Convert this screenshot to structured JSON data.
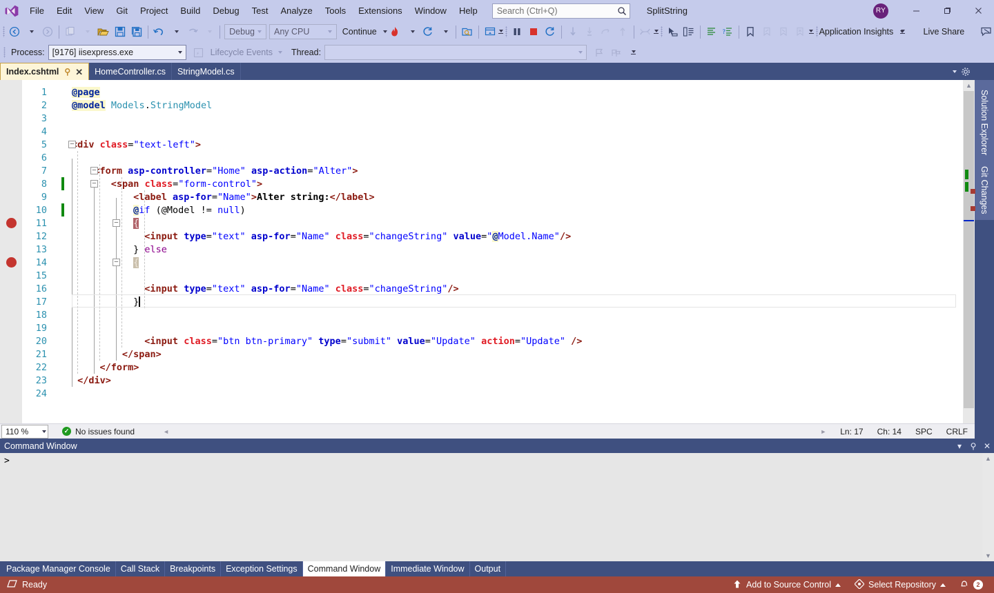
{
  "window": {
    "title": "SplitString",
    "avatar_initials": "RY",
    "minimize": "–",
    "maximize": "❐",
    "close": "✕"
  },
  "menu": {
    "items": [
      "File",
      "Edit",
      "View",
      "Git",
      "Project",
      "Build",
      "Debug",
      "Test",
      "Analyze",
      "Tools",
      "Extensions",
      "Window",
      "Help"
    ]
  },
  "search": {
    "placeholder": "Search (Ctrl+Q)",
    "icon": "search-icon"
  },
  "toolbar": {
    "nav_back": "back-arrow-icon",
    "nav_forward": "forward-arrow-icon",
    "new_item": "new-item-icon",
    "open_file": "open-folder-icon",
    "save": "save-icon",
    "save_all": "save-all-icon",
    "undo": "undo-icon",
    "redo": "redo-icon",
    "config_combo": "Debug",
    "platform_combo": "Any CPU",
    "continue_label": "Continue",
    "hot_reload": "hot-reload-icon",
    "restart_app": "restart-icon",
    "browser_select": "browser-select-icon",
    "show_window": "show-window-icon",
    "break_all": "pause-icon",
    "stop_debugging": "stop-icon",
    "restart_debug": "restart-debug-icon",
    "step_into": "step-into-icon",
    "step_over": "step-over-icon",
    "step_out": "step-out-icon",
    "step_up": "step-up-icon",
    "app_insights": "Application Insights",
    "live_share": "Live Share",
    "live_share_icon": "share-icon",
    "feedback_icon": "feedback-icon",
    "bookmark_icon": "bookmark-icon"
  },
  "processbar": {
    "process_label": "Process:",
    "process_value": "[9176] iisexpress.exe",
    "lifecycle_label": "Lifecycle Events",
    "thread_label": "Thread:",
    "thread_value": ""
  },
  "tabs": {
    "items": [
      {
        "label": "Index.cshtml",
        "active": true,
        "pin": "⚲",
        "close": "✕"
      },
      {
        "label": "HomeController.cs",
        "active": false
      },
      {
        "label": "StringModel.cs",
        "active": false
      }
    ]
  },
  "editor": {
    "breakpoint_lines": [
      11,
      14
    ],
    "changed_lines": [
      8,
      10
    ],
    "current_line": 17,
    "lines": [
      {
        "n": 1,
        "indent": 0,
        "tokens": [
          {
            "t": "@page",
            "c": "t-dir"
          }
        ]
      },
      {
        "n": 2,
        "indent": 0,
        "tokens": [
          {
            "t": "@model",
            "c": "t-dir"
          },
          {
            "t": " ",
            "c": "t-plain"
          },
          {
            "t": "Models",
            "c": "t-type"
          },
          {
            "t": ".",
            "c": "t-plain"
          },
          {
            "t": "StringModel",
            "c": "t-type"
          }
        ]
      },
      {
        "n": 3,
        "indent": 0,
        "tokens": []
      },
      {
        "n": 4,
        "indent": 0,
        "tokens": []
      },
      {
        "n": 5,
        "indent": 0,
        "tokens": [
          {
            "t": "<div ",
            "c": "t-tag"
          },
          {
            "t": "class",
            "c": "t-attr"
          },
          {
            "t": "=",
            "c": "t-plain"
          },
          {
            "t": "\"text-left\"",
            "c": "t-val"
          },
          {
            "t": ">",
            "c": "t-tag"
          }
        ]
      },
      {
        "n": 6,
        "indent": 0,
        "tokens": []
      },
      {
        "n": 7,
        "indent": 4,
        "tokens": [
          {
            "t": "<form ",
            "c": "t-tag"
          },
          {
            "t": "asp-controller",
            "c": "t-attrb"
          },
          {
            "t": "=",
            "c": "t-plain"
          },
          {
            "t": "\"Home\"",
            "c": "t-val"
          },
          {
            "t": " ",
            "c": "t-plain"
          },
          {
            "t": "asp-action",
            "c": "t-attrb"
          },
          {
            "t": "=",
            "c": "t-plain"
          },
          {
            "t": "\"Alter\"",
            "c": "t-val"
          },
          {
            "t": ">",
            "c": "t-tag"
          }
        ]
      },
      {
        "n": 8,
        "indent": 7,
        "tokens": [
          {
            "t": "<span ",
            "c": "t-tag"
          },
          {
            "t": "class",
            "c": "t-attr"
          },
          {
            "t": "=",
            "c": "t-plain"
          },
          {
            "t": "\"form-control\"",
            "c": "t-val"
          },
          {
            "t": ">",
            "c": "t-tag"
          }
        ]
      },
      {
        "n": 9,
        "indent": 11,
        "tokens": [
          {
            "t": "<label ",
            "c": "t-tag"
          },
          {
            "t": "asp-for",
            "c": "t-attrb"
          },
          {
            "t": "=",
            "c": "t-plain"
          },
          {
            "t": "\"Name\"",
            "c": "t-val"
          },
          {
            "t": ">",
            "c": "t-tag"
          },
          {
            "t": "Alter string:",
            "c": "t-txt"
          },
          {
            "t": "</label>",
            "c": "t-tag"
          }
        ]
      },
      {
        "n": 10,
        "indent": 11,
        "tokens": [
          {
            "t": "@",
            "c": "t-at"
          },
          {
            "t": "if",
            "c": "t-kw"
          },
          {
            "t": " (",
            "c": "t-plain"
          },
          {
            "t": "@Model",
            "c": "t-plain"
          },
          {
            "t": " != ",
            "c": "t-plain"
          },
          {
            "t": "null",
            "c": "t-kw"
          },
          {
            "t": ")",
            "c": "t-plain"
          }
        ]
      },
      {
        "n": 11,
        "indent": 11,
        "tokens": [
          {
            "t": "{",
            "c": "t-brace-bp"
          }
        ]
      },
      {
        "n": 12,
        "indent": 13,
        "tokens": [
          {
            "t": "<input ",
            "c": "t-tag"
          },
          {
            "t": "type",
            "c": "t-attrb"
          },
          {
            "t": "=",
            "c": "t-plain"
          },
          {
            "t": "\"text\"",
            "c": "t-val"
          },
          {
            "t": " ",
            "c": "t-plain"
          },
          {
            "t": "asp-for",
            "c": "t-attrb"
          },
          {
            "t": "=",
            "c": "t-plain"
          },
          {
            "t": "\"Name\"",
            "c": "t-val"
          },
          {
            "t": " ",
            "c": "t-plain"
          },
          {
            "t": "class",
            "c": "t-attr"
          },
          {
            "t": "=",
            "c": "t-plain"
          },
          {
            "t": "\"changeString\"",
            "c": "t-val"
          },
          {
            "t": " ",
            "c": "t-plain"
          },
          {
            "t": "value",
            "c": "t-attrb"
          },
          {
            "t": "=",
            "c": "t-plain"
          },
          {
            "t": "\"",
            "c": "t-val"
          },
          {
            "t": "@",
            "c": "t-at"
          },
          {
            "t": "Model.Name\"",
            "c": "t-val"
          },
          {
            "t": "/>",
            "c": "t-tag"
          }
        ]
      },
      {
        "n": 13,
        "indent": 11,
        "tokens": [
          {
            "t": "} ",
            "c": "t-plain"
          },
          {
            "t": "else",
            "c": "t-kw2"
          }
        ]
      },
      {
        "n": 14,
        "indent": 11,
        "tokens": [
          {
            "t": "{",
            "c": "t-brace-tan"
          }
        ]
      },
      {
        "n": 15,
        "indent": 0,
        "tokens": []
      },
      {
        "n": 16,
        "indent": 13,
        "tokens": [
          {
            "t": "<input ",
            "c": "t-tag"
          },
          {
            "t": "type",
            "c": "t-attrb"
          },
          {
            "t": "=",
            "c": "t-plain"
          },
          {
            "t": "\"text\"",
            "c": "t-val"
          },
          {
            "t": " ",
            "c": "t-plain"
          },
          {
            "t": "asp-for",
            "c": "t-attrb"
          },
          {
            "t": "=",
            "c": "t-plain"
          },
          {
            "t": "\"Name\"",
            "c": "t-val"
          },
          {
            "t": " ",
            "c": "t-plain"
          },
          {
            "t": "class",
            "c": "t-attr"
          },
          {
            "t": "=",
            "c": "t-plain"
          },
          {
            "t": "\"changeString\"",
            "c": "t-val"
          },
          {
            "t": "/>",
            "c": "t-tag"
          }
        ]
      },
      {
        "n": 17,
        "indent": 11,
        "tokens": [
          {
            "t": "}",
            "c": "t-plain"
          }
        ]
      },
      {
        "n": 18,
        "indent": 0,
        "tokens": []
      },
      {
        "n": 19,
        "indent": 0,
        "tokens": []
      },
      {
        "n": 20,
        "indent": 13,
        "tokens": [
          {
            "t": "<input ",
            "c": "t-tag"
          },
          {
            "t": "class",
            "c": "t-attr"
          },
          {
            "t": "=",
            "c": "t-plain"
          },
          {
            "t": "\"btn btn-primary\"",
            "c": "t-val"
          },
          {
            "t": " ",
            "c": "t-plain"
          },
          {
            "t": "type",
            "c": "t-attrb"
          },
          {
            "t": "=",
            "c": "t-plain"
          },
          {
            "t": "\"submit\"",
            "c": "t-val"
          },
          {
            "t": " ",
            "c": "t-plain"
          },
          {
            "t": "value",
            "c": "t-attrb"
          },
          {
            "t": "=",
            "c": "t-plain"
          },
          {
            "t": "\"Update\"",
            "c": "t-val"
          },
          {
            "t": " ",
            "c": "t-plain"
          },
          {
            "t": "action",
            "c": "t-attr"
          },
          {
            "t": "=",
            "c": "t-plain"
          },
          {
            "t": "\"Update\"",
            "c": "t-val"
          },
          {
            "t": " />",
            "c": "t-tag"
          }
        ]
      },
      {
        "n": 21,
        "indent": 9,
        "tokens": [
          {
            "t": "</span>",
            "c": "t-tag"
          }
        ]
      },
      {
        "n": 22,
        "indent": 5,
        "tokens": [
          {
            "t": "</form>",
            "c": "t-tag"
          }
        ]
      },
      {
        "n": 23,
        "indent": 1,
        "tokens": [
          {
            "t": "</div>",
            "c": "t-tag"
          }
        ]
      },
      {
        "n": 24,
        "indent": 0,
        "tokens": []
      }
    ]
  },
  "editor_status": {
    "zoom": "110 %",
    "issues": "No issues found",
    "issues_icon": "check-circle-icon",
    "line": "Ln: 17",
    "col": "Ch: 14",
    "spaces": "SPC",
    "eol": "CRLF"
  },
  "right_dock": {
    "tabs": [
      "Solution Explorer",
      "Git Changes"
    ],
    "settings_icon": "gear-icon",
    "splitter_icon": "split-view-icon"
  },
  "panel": {
    "title": "Command Window",
    "prompt": ">",
    "buttons": {
      "dropdown": "▾",
      "pin": "⚲",
      "close": "✕"
    },
    "tabs": [
      {
        "label": "Package Manager Console",
        "active": false
      },
      {
        "label": "Call Stack",
        "active": false
      },
      {
        "label": "Breakpoints",
        "active": false
      },
      {
        "label": "Exception Settings",
        "active": false
      },
      {
        "label": "Command Window",
        "active": true
      },
      {
        "label": "Immediate Window",
        "active": false
      },
      {
        "label": "Output",
        "active": false
      }
    ]
  },
  "statusbar": {
    "state": "Ready",
    "state_icon": "debug-state-icon",
    "source_control": "Add to Source Control",
    "repository": "Select Repository",
    "repository_icon": "git-icon",
    "notifications_count": "2",
    "notifications_icon": "bell-icon"
  },
  "colors": {
    "chrome": "#C5CBEB",
    "dock": "#3F5080",
    "debug_status": "#A0483C",
    "accent_tab": "#FDF5D8",
    "breakpoint": "#C4352F",
    "change_bar": "#108A10"
  }
}
